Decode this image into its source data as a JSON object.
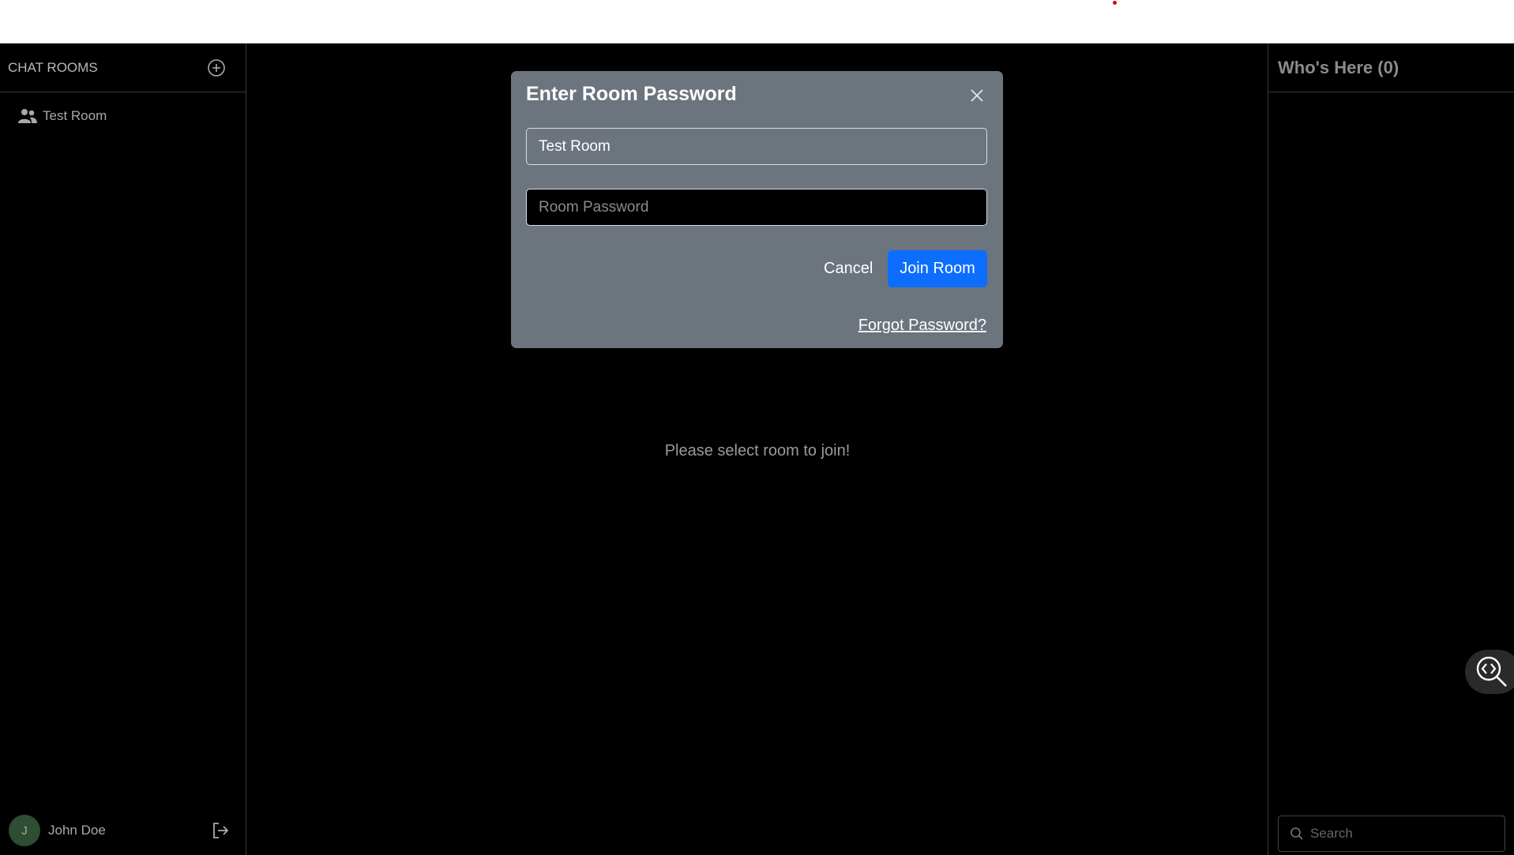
{
  "sidebar": {
    "title": "CHAT ROOMS",
    "rooms": [
      {
        "label": "Test Room"
      }
    ]
  },
  "user": {
    "initial": "J",
    "name": "John Doe"
  },
  "main": {
    "empty_message": "Please select room to join!"
  },
  "right_panel": {
    "title": "Who's Here (0)",
    "search_placeholder": "Search"
  },
  "modal": {
    "title": "Enter Room Password",
    "room_value": "Test Room",
    "password_placeholder": "Room Password",
    "cancel_label": "Cancel",
    "join_label": "Join Room",
    "forgot_label": "Forgot Password?"
  },
  "colors": {
    "accent": "#0d6efd",
    "modal_bg": "#6c747e",
    "avatar_bg": "#2e4d33"
  },
  "icons": [
    "add-circle-icon",
    "people-icon",
    "logout-icon",
    "close-icon",
    "search-icon",
    "code-search-icon"
  ]
}
